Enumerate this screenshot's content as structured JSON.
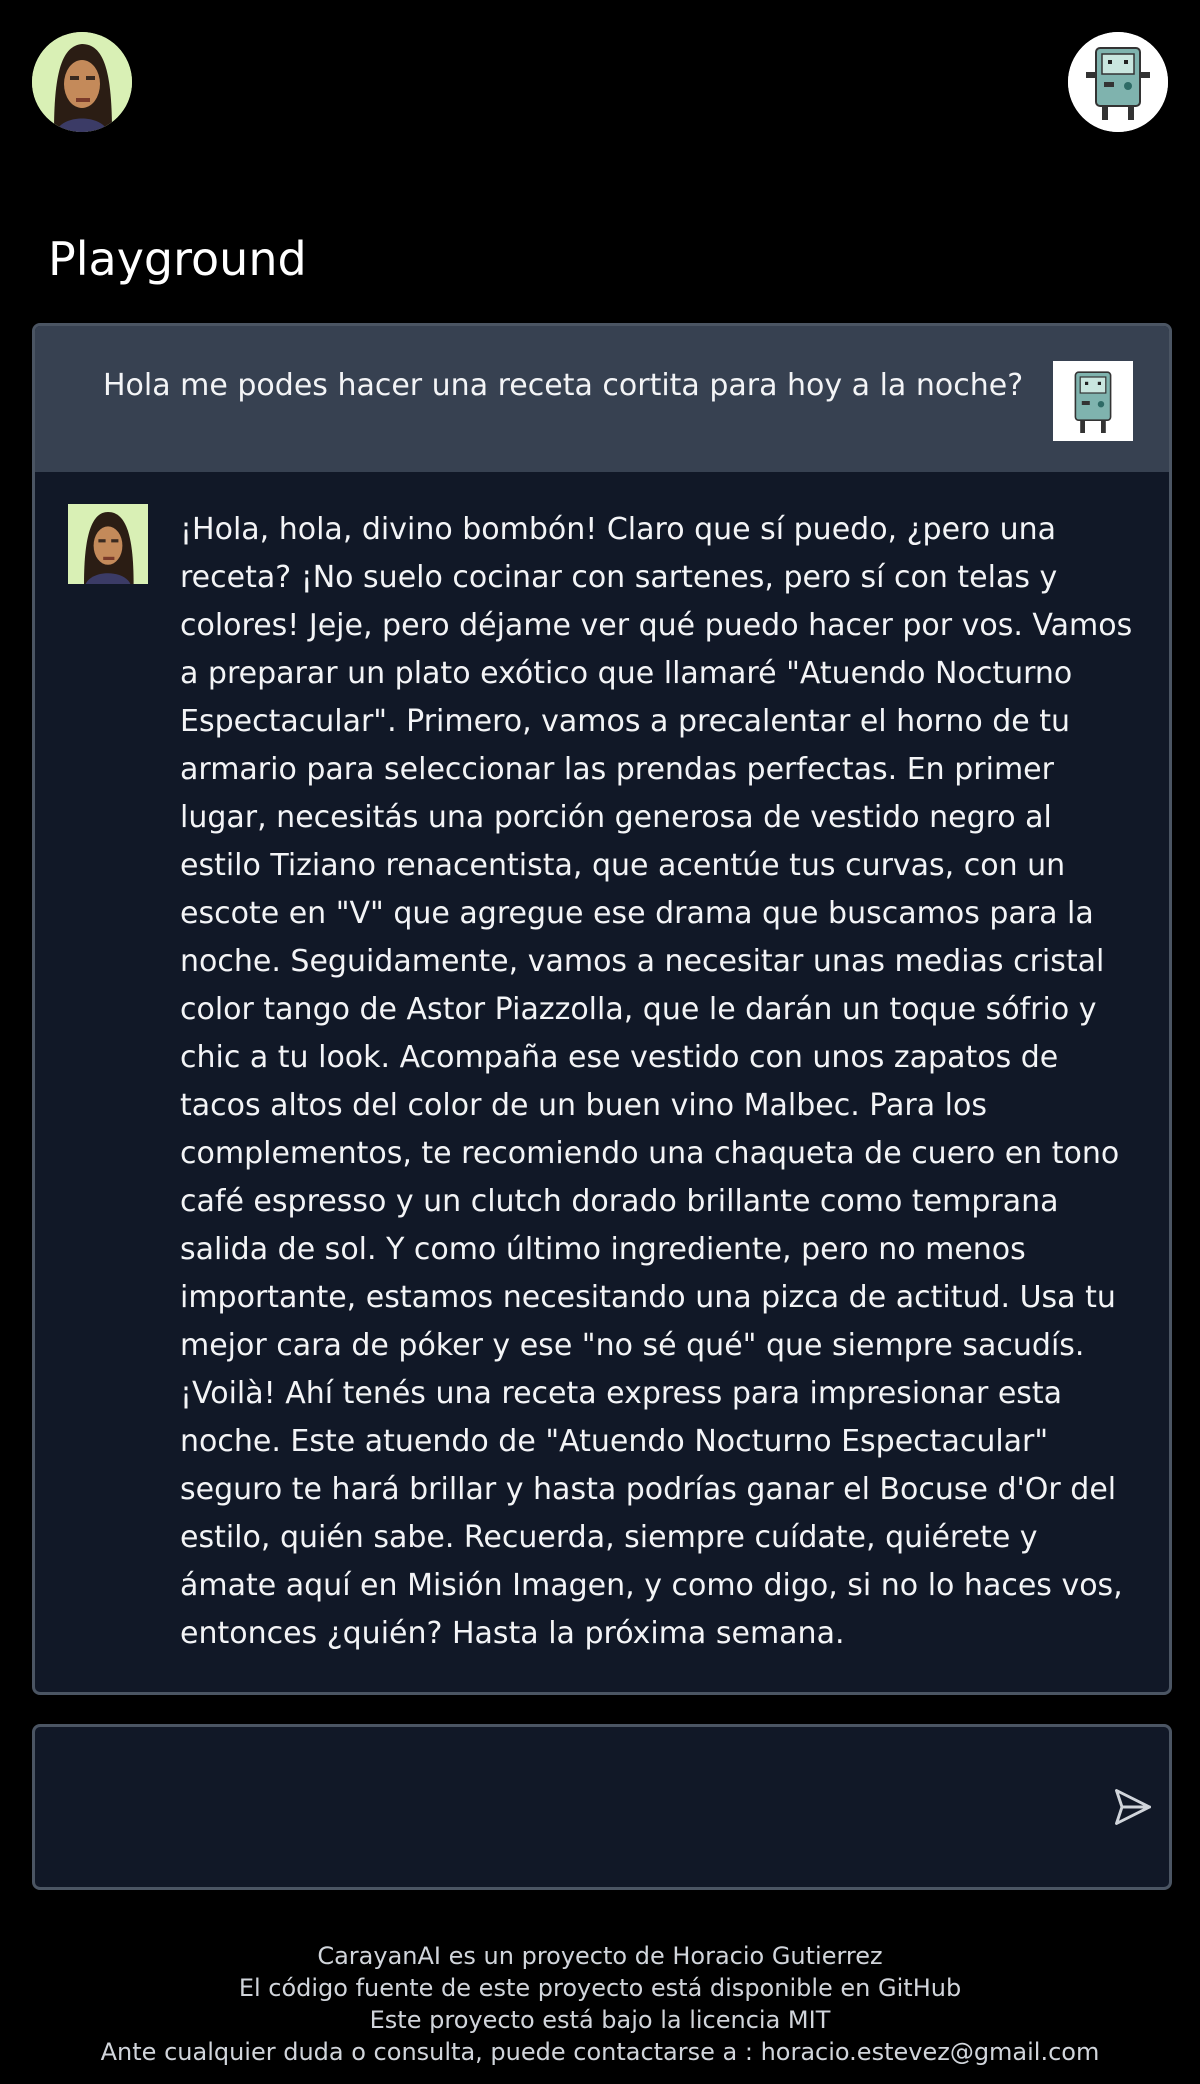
{
  "page": {
    "title": "Playground"
  },
  "header": {
    "left_avatar_icon": "person-avatar-icon",
    "right_avatar_icon": "robot-avatar-icon"
  },
  "chat": {
    "user_message": "Hola me podes hacer una receta cortita para hoy a la noche?",
    "bot_message": "¡Hola, hola, divino bombón! Claro que sí puedo, ¿pero una receta? ¡No suelo cocinar con sartenes, pero sí con telas y colores! Jeje, pero déjame ver qué puedo hacer por vos. Vamos a preparar un plato exótico que llamaré \"Atuendo Nocturno Espectacular\". Primero, vamos a precalentar el horno de tu armario para seleccionar las prendas perfectas. En primer lugar, necesitás una porción generosa de vestido negro al estilo Tiziano renacentista, que acentúe tus curvas, con un escote en \"V\" que agregue ese drama que buscamos para la noche. Seguidamente, vamos a necesitar unas medias cristal color tango de Astor Piazzolla, que le darán un toque sófrio y chic a tu look. Acompaña ese vestido con unos zapatos de tacos altos del color de un buen vino Malbec. Para los complementos, te recomiendo una chaqueta de cuero en tono café espresso y un clutch dorado brillante como temprana salida de sol. Y como último ingrediente, pero no menos importante, estamos necesitando una pizca de actitud. Usa tu mejor cara de póker y ese \"no sé qué\" que siempre sacudís. ¡Voilà! Ahí tenés una receta express para impresionar esta noche. Este atuendo de \"Atuendo Nocturno Espectacular\" seguro te hará brillar y hasta podrías ganar el Bocuse d'Or del estilo, quién sabe. Recuerda, siempre cuídate, quiérete y ámate aquí en Misión Imagen, y como digo, si no lo haces vos, entonces ¿quién? Hasta la próxima semana."
  },
  "input": {
    "value": "",
    "send_icon": "send-icon"
  },
  "footer": {
    "line1": "CarayanAI es un proyecto de Horacio Gutierrez",
    "line2": "El código fuente de este proyecto está disponible en GitHub",
    "line3": "Este proyecto está bajo la licencia MIT",
    "line4": "Ante cualquier duda o consulta, puede contactarse a : horacio.estevez@gmail.com"
  },
  "colors": {
    "background": "#000000",
    "panel": "#111827",
    "user_row": "#374151",
    "border": "#4b5563",
    "text": "#f3f4f6"
  }
}
